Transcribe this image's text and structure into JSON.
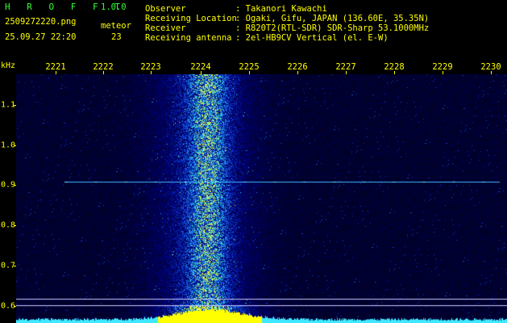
{
  "header": {
    "app_name": "H R O F F T",
    "version": "1.0.0",
    "filename": "2509272220.png",
    "datetime": "25.09.27 22:20",
    "count_label": "meteor",
    "count_value": "23",
    "info": [
      {
        "label": "Observer",
        "value": ": Takanori Kawachi"
      },
      {
        "label": "Receiving Location",
        "value": ": Ogaki, Gifu, JAPAN (136.60E, 35.35N)"
      },
      {
        "label": "Receiver",
        "value": ": R820T2(RTL-SDR) SDR-Sharp 53.1000MHz"
      },
      {
        "label": "Receiving antenna",
        "value": ": 2el-HB9CV Vertical (el. E-W)"
      }
    ]
  },
  "axes": {
    "y_unit": "kHz",
    "x_labels": [
      "2221",
      "2222",
      "2223",
      "2224",
      "2225",
      "2226",
      "2227",
      "2228",
      "2229",
      "2230"
    ],
    "y_labels": [
      "1.1",
      "1.0",
      "0.9",
      "0.8",
      "0.7",
      "0.6"
    ]
  },
  "colors": {
    "label_yellow": "#ffff00",
    "title_green": "#30ff30",
    "background": "#000000",
    "noise_blue": "#1020a0",
    "signal_cyan": "#40e8ff"
  }
}
